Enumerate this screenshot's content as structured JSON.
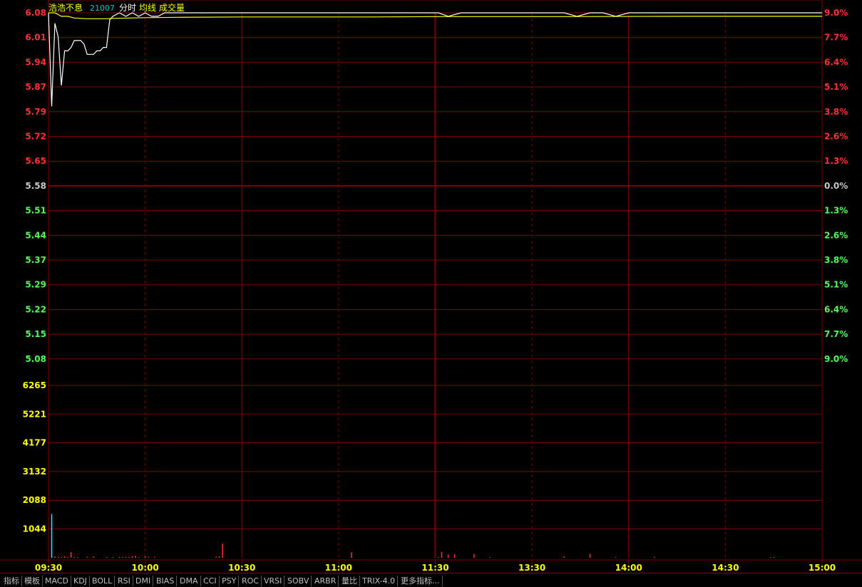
{
  "header": {
    "stock_name": "浩浩不息",
    "volume": "21007",
    "legend": [
      "分时",
      "均线",
      "成交量"
    ]
  },
  "price_axis": {
    "left_labels": [
      "6.08",
      "6.01",
      "5.94",
      "5.87",
      "5.79",
      "5.72",
      "5.65",
      "5.58",
      "5.51",
      "5.44",
      "5.37",
      "5.29",
      "5.22",
      "5.15",
      "5.08"
    ],
    "right_labels": [
      "9.0%",
      "7.7%",
      "6.4%",
      "5.1%",
      "3.8%",
      "2.6%",
      "1.3%",
      "0.0%",
      "1.3%",
      "2.6%",
      "3.8%",
      "5.1%",
      "6.4%",
      "7.7%",
      "9.0%"
    ]
  },
  "volume_axis": {
    "labels": [
      "6265",
      "5221",
      "4177",
      "3132",
      "2088",
      "1044"
    ]
  },
  "time_axis": {
    "labels": [
      "09:30",
      "10:00",
      "10:30",
      "11:00",
      "11:30",
      "13:30",
      "14:00",
      "14:30",
      "15:00"
    ]
  },
  "colors": {
    "grid": "#800000",
    "up": "#ff3232",
    "down": "#54ff54",
    "neutral": "#c8c8c8",
    "price_line": "#ffffff",
    "avg_line": "#ffff00",
    "volume_label": "#ffff00",
    "volume_bar": "#ff3232",
    "volume_bar_first": "#00ffff",
    "name_color": "#ffff00",
    "code_color": "#00c8c8"
  },
  "tabs": [
    "指标",
    "模板",
    "MACD",
    "KDJ",
    "BOLL",
    "RSI",
    "DMI",
    "BIAS",
    "DMA",
    "CCI",
    "PSY",
    "ROC",
    "VRSI",
    "SOBV",
    "ARBR",
    "量比",
    "TRIX-4.0",
    "更多指标..."
  ],
  "chart_data": {
    "type": "line",
    "title": "",
    "ylim": [
      5.08,
      6.08
    ],
    "base_price": 5.58,
    "series": [
      {
        "name": "分时",
        "x": [
          0,
          1,
          2,
          3,
          4,
          5,
          6,
          7,
          8,
          9,
          10,
          11,
          12,
          13,
          14,
          15,
          16,
          17,
          18,
          19,
          20,
          22,
          24,
          26,
          28,
          30,
          32,
          34,
          36,
          38,
          40,
          44,
          48,
          52,
          56,
          60,
          64,
          68,
          72,
          76,
          80,
          84,
          88,
          92,
          96,
          100,
          104,
          108,
          112,
          116,
          120,
          121,
          124,
          128,
          132,
          136,
          140,
          144,
          148,
          152,
          156,
          160,
          164,
          168,
          172,
          176,
          180,
          184,
          188,
          196,
          204,
          212,
          220,
          228,
          236,
          240
        ],
        "values": [
          6.08,
          5.81,
          6.05,
          6.01,
          5.87,
          5.97,
          5.97,
          5.98,
          6.0,
          6.0,
          6.0,
          5.99,
          5.96,
          5.96,
          5.96,
          5.97,
          5.97,
          5.98,
          5.98,
          6.06,
          6.07,
          6.08,
          6.07,
          6.08,
          6.07,
          6.08,
          6.07,
          6.07,
          6.08,
          6.08,
          6.08,
          6.08,
          6.08,
          6.08,
          6.08,
          6.08,
          6.08,
          6.08,
          6.08,
          6.08,
          6.08,
          6.08,
          6.08,
          6.08,
          6.08,
          6.08,
          6.08,
          6.08,
          6.08,
          6.08,
          6.08,
          6.08,
          6.07,
          6.08,
          6.08,
          6.08,
          6.08,
          6.08,
          6.08,
          6.08,
          6.08,
          6.08,
          6.07,
          6.08,
          6.08,
          6.07,
          6.08,
          6.08,
          6.08,
          6.08,
          6.08,
          6.08,
          6.08,
          6.08,
          6.08,
          6.08
        ]
      },
      {
        "name": "均线",
        "x": [
          0,
          2,
          4,
          6,
          8,
          10,
          12,
          14,
          16,
          18,
          20,
          25,
          30,
          40,
          60,
          80,
          100,
          120,
          160,
          200,
          240
        ],
        "values": [
          6.08,
          6.08,
          6.07,
          6.07,
          6.065,
          6.064,
          6.063,
          6.063,
          6.063,
          6.063,
          6.064,
          6.065,
          6.066,
          6.067,
          6.068,
          6.068,
          6.068,
          6.069,
          6.069,
          6.07,
          6.07
        ]
      }
    ],
    "volume": {
      "ylim": [
        0,
        7309
      ],
      "x": [
        1,
        2,
        3,
        4,
        5,
        6,
        7,
        8,
        9,
        12,
        14,
        18,
        20,
        22,
        23,
        24,
        25,
        26,
        27,
        28,
        30,
        31,
        33,
        52,
        53,
        54,
        94,
        121,
        122,
        124,
        126,
        132,
        137,
        160,
        168,
        176,
        188,
        224,
        225
      ],
      "values": [
        1850,
        60,
        40,
        30,
        70,
        40,
        240,
        40,
        30,
        40,
        60,
        30,
        30,
        40,
        30,
        40,
        30,
        60,
        90,
        30,
        60,
        30,
        40,
        40,
        60,
        600,
        240,
        30,
        250,
        130,
        150,
        160,
        30,
        60,
        170,
        30,
        40,
        30,
        30
      ]
    }
  }
}
